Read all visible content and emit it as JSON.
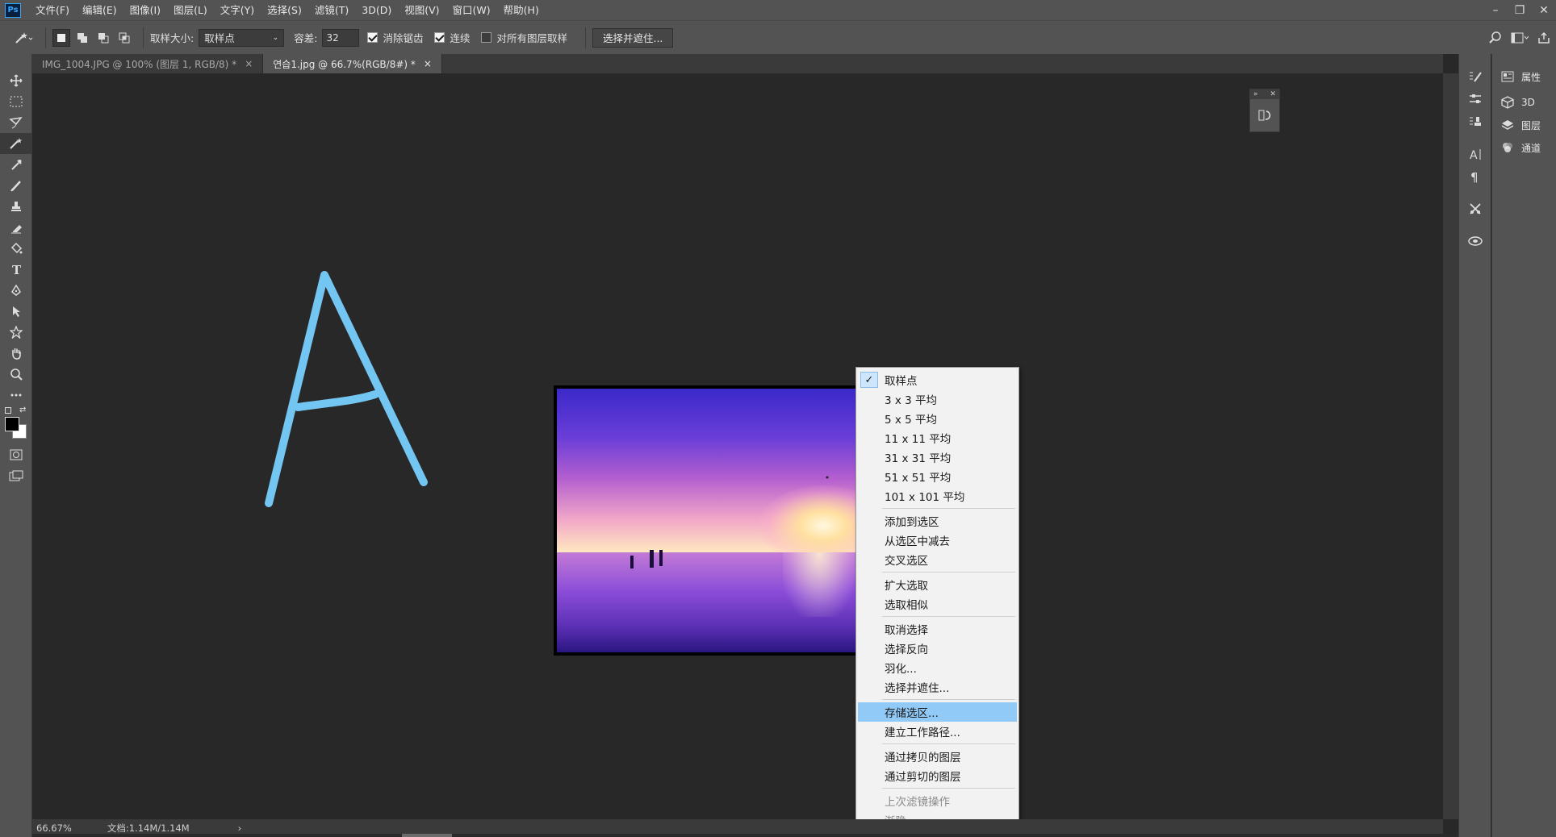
{
  "app": {
    "logo": "Ps"
  },
  "menubar": {
    "items": [
      "文件(F)",
      "编辑(E)",
      "图像(I)",
      "图层(L)",
      "文字(Y)",
      "选择(S)",
      "滤镜(T)",
      "3D(D)",
      "视图(V)",
      "窗口(W)",
      "帮助(H)"
    ]
  },
  "options": {
    "sample_size_label": "取样大小:",
    "sample_size_value": "取样点",
    "tolerance_label": "容差:",
    "tolerance_value": "32",
    "antialias_label": "消除锯齿",
    "antialias_checked": true,
    "contiguous_label": "连续",
    "contiguous_checked": true,
    "sample_all_label": "对所有图层取样",
    "sample_all_checked": false,
    "select_mask_button": "选择并遮住..."
  },
  "tabs": [
    {
      "label": "IMG_1004.JPG @ 100% (图层 1, RGB/8) *",
      "active": false
    },
    {
      "label": "연습1.jpg @ 66.7%(RGB/8#) *",
      "active": true
    }
  ],
  "context_menu": {
    "groups": [
      [
        {
          "label": "取样点",
          "checked": true
        },
        {
          "label": "3 x 3 平均"
        },
        {
          "label": "5 x 5 平均"
        },
        {
          "label": "11 x 11 平均"
        },
        {
          "label": "31 x 31 平均"
        },
        {
          "label": "51 x 51 平均"
        },
        {
          "label": "101 x 101 平均"
        }
      ],
      [
        {
          "label": "添加到选区"
        },
        {
          "label": "从选区中减去"
        },
        {
          "label": "交叉选区"
        }
      ],
      [
        {
          "label": "扩大选取"
        },
        {
          "label": "选取相似"
        }
      ],
      [
        {
          "label": "取消选择"
        },
        {
          "label": "选择反向"
        },
        {
          "label": "羽化..."
        },
        {
          "label": "选择并遮住..."
        }
      ],
      [
        {
          "label": "存储选区...",
          "highlighted": true
        },
        {
          "label": "建立工作路径..."
        }
      ],
      [
        {
          "label": "通过拷贝的图层"
        },
        {
          "label": "通过剪切的图层"
        }
      ],
      [
        {
          "label": "上次滤镜操作",
          "disabled": true
        },
        {
          "label": "渐隐...",
          "disabled": true
        }
      ]
    ]
  },
  "right_panel": {
    "items": [
      {
        "label": "属性",
        "icon": "properties-icon"
      },
      {
        "label": "3D",
        "icon": "cube-icon"
      },
      {
        "label": "图层",
        "icon": "layers-icon"
      },
      {
        "label": "通道",
        "icon": "channels-icon"
      }
    ]
  },
  "status": {
    "zoom": "66.67%",
    "doc": "文档:1.14M/1.14M",
    "arrow": "›"
  },
  "colors": {
    "accent": "#31a8ff",
    "menu_highlight": "#91c9f7",
    "stroke_a": "#74c6f2"
  }
}
